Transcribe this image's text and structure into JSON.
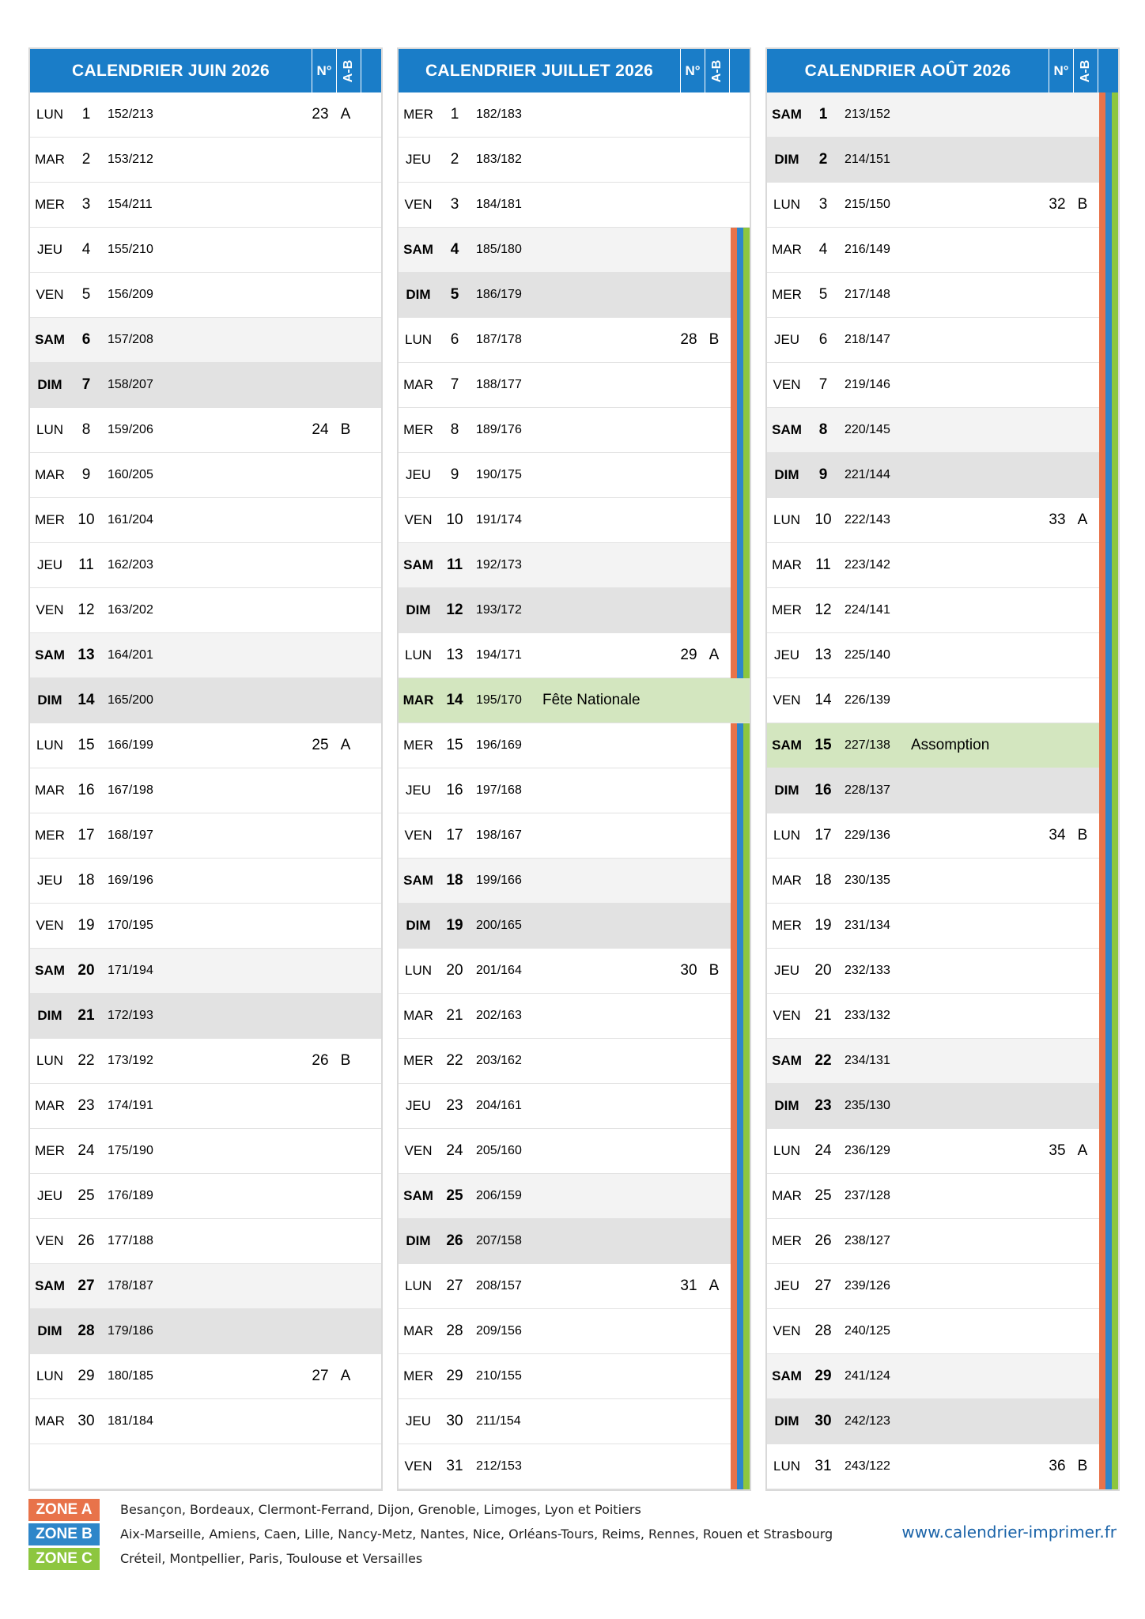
{
  "colors": {
    "header": "#1a7dc8",
    "zone_a": "#e8734a",
    "zone_b": "#2e86c9",
    "zone_c": "#8dc63f",
    "holiday": "#d3e6bf",
    "saturday": "#f3f3f3",
    "sunday": "#e2e2e2"
  },
  "months": [
    {
      "title": "CALENDRIER JUIN 2026",
      "col_no": "N°",
      "col_ab": "A-B",
      "days": [
        {
          "dn": "LUN",
          "d": "1",
          "y": "152/213",
          "hol": "",
          "wk": "23",
          "ab": "A",
          "t": "w",
          "z": false
        },
        {
          "dn": "MAR",
          "d": "2",
          "y": "153/212",
          "hol": "",
          "wk": "",
          "ab": "",
          "t": "w",
          "z": false
        },
        {
          "dn": "MER",
          "d": "3",
          "y": "154/211",
          "hol": "",
          "wk": "",
          "ab": "",
          "t": "w",
          "z": false
        },
        {
          "dn": "JEU",
          "d": "4",
          "y": "155/210",
          "hol": "",
          "wk": "",
          "ab": "",
          "t": "w",
          "z": false
        },
        {
          "dn": "VEN",
          "d": "5",
          "y": "156/209",
          "hol": "",
          "wk": "",
          "ab": "",
          "t": "w",
          "z": false
        },
        {
          "dn": "SAM",
          "d": "6",
          "y": "157/208",
          "hol": "",
          "wk": "",
          "ab": "",
          "t": "sat",
          "z": false
        },
        {
          "dn": "DIM",
          "d": "7",
          "y": "158/207",
          "hol": "",
          "wk": "",
          "ab": "",
          "t": "sun",
          "z": false
        },
        {
          "dn": "LUN",
          "d": "8",
          "y": "159/206",
          "hol": "",
          "wk": "24",
          "ab": "B",
          "t": "w",
          "z": false
        },
        {
          "dn": "MAR",
          "d": "9",
          "y": "160/205",
          "hol": "",
          "wk": "",
          "ab": "",
          "t": "w",
          "z": false
        },
        {
          "dn": "MER",
          "d": "10",
          "y": "161/204",
          "hol": "",
          "wk": "",
          "ab": "",
          "t": "w",
          "z": false
        },
        {
          "dn": "JEU",
          "d": "11",
          "y": "162/203",
          "hol": "",
          "wk": "",
          "ab": "",
          "t": "w",
          "z": false
        },
        {
          "dn": "VEN",
          "d": "12",
          "y": "163/202",
          "hol": "",
          "wk": "",
          "ab": "",
          "t": "w",
          "z": false
        },
        {
          "dn": "SAM",
          "d": "13",
          "y": "164/201",
          "hol": "",
          "wk": "",
          "ab": "",
          "t": "sat",
          "z": false
        },
        {
          "dn": "DIM",
          "d": "14",
          "y": "165/200",
          "hol": "",
          "wk": "",
          "ab": "",
          "t": "sun",
          "z": false
        },
        {
          "dn": "LUN",
          "d": "15",
          "y": "166/199",
          "hol": "",
          "wk": "25",
          "ab": "A",
          "t": "w",
          "z": false
        },
        {
          "dn": "MAR",
          "d": "16",
          "y": "167/198",
          "hol": "",
          "wk": "",
          "ab": "",
          "t": "w",
          "z": false
        },
        {
          "dn": "MER",
          "d": "17",
          "y": "168/197",
          "hol": "",
          "wk": "",
          "ab": "",
          "t": "w",
          "z": false
        },
        {
          "dn": "JEU",
          "d": "18",
          "y": "169/196",
          "hol": "",
          "wk": "",
          "ab": "",
          "t": "w",
          "z": false
        },
        {
          "dn": "VEN",
          "d": "19",
          "y": "170/195",
          "hol": "",
          "wk": "",
          "ab": "",
          "t": "w",
          "z": false
        },
        {
          "dn": "SAM",
          "d": "20",
          "y": "171/194",
          "hol": "",
          "wk": "",
          "ab": "",
          "t": "sat",
          "z": false
        },
        {
          "dn": "DIM",
          "d": "21",
          "y": "172/193",
          "hol": "",
          "wk": "",
          "ab": "",
          "t": "sun",
          "z": false
        },
        {
          "dn": "LUN",
          "d": "22",
          "y": "173/192",
          "hol": "",
          "wk": "26",
          "ab": "B",
          "t": "w",
          "z": false
        },
        {
          "dn": "MAR",
          "d": "23",
          "y": "174/191",
          "hol": "",
          "wk": "",
          "ab": "",
          "t": "w",
          "z": false
        },
        {
          "dn": "MER",
          "d": "24",
          "y": "175/190",
          "hol": "",
          "wk": "",
          "ab": "",
          "t": "w",
          "z": false
        },
        {
          "dn": "JEU",
          "d": "25",
          "y": "176/189",
          "hol": "",
          "wk": "",
          "ab": "",
          "t": "w",
          "z": false
        },
        {
          "dn": "VEN",
          "d": "26",
          "y": "177/188",
          "hol": "",
          "wk": "",
          "ab": "",
          "t": "w",
          "z": false
        },
        {
          "dn": "SAM",
          "d": "27",
          "y": "178/187",
          "hol": "",
          "wk": "",
          "ab": "",
          "t": "sat",
          "z": false
        },
        {
          "dn": "DIM",
          "d": "28",
          "y": "179/186",
          "hol": "",
          "wk": "",
          "ab": "",
          "t": "sun",
          "z": false
        },
        {
          "dn": "LUN",
          "d": "29",
          "y": "180/185",
          "hol": "",
          "wk": "27",
          "ab": "A",
          "t": "w",
          "z": false
        },
        {
          "dn": "MAR",
          "d": "30",
          "y": "181/184",
          "hol": "",
          "wk": "",
          "ab": "",
          "t": "w",
          "z": false
        },
        {
          "dn": "",
          "d": "",
          "y": "",
          "hol": "",
          "wk": "",
          "ab": "",
          "t": "empty",
          "z": false
        }
      ]
    },
    {
      "title": "CALENDRIER JUILLET 2026",
      "col_no": "N°",
      "col_ab": "A-B",
      "days": [
        {
          "dn": "MER",
          "d": "1",
          "y": "182/183",
          "hol": "",
          "wk": "",
          "ab": "",
          "t": "w",
          "z": false
        },
        {
          "dn": "JEU",
          "d": "2",
          "y": "183/182",
          "hol": "",
          "wk": "",
          "ab": "",
          "t": "w",
          "z": false
        },
        {
          "dn": "VEN",
          "d": "3",
          "y": "184/181",
          "hol": "",
          "wk": "",
          "ab": "",
          "t": "w",
          "z": false
        },
        {
          "dn": "SAM",
          "d": "4",
          "y": "185/180",
          "hol": "",
          "wk": "",
          "ab": "",
          "t": "sat",
          "z": true
        },
        {
          "dn": "DIM",
          "d": "5",
          "y": "186/179",
          "hol": "",
          "wk": "",
          "ab": "",
          "t": "sun",
          "z": true
        },
        {
          "dn": "LUN",
          "d": "6",
          "y": "187/178",
          "hol": "",
          "wk": "28",
          "ab": "B",
          "t": "w",
          "z": true
        },
        {
          "dn": "MAR",
          "d": "7",
          "y": "188/177",
          "hol": "",
          "wk": "",
          "ab": "",
          "t": "w",
          "z": true
        },
        {
          "dn": "MER",
          "d": "8",
          "y": "189/176",
          "hol": "",
          "wk": "",
          "ab": "",
          "t": "w",
          "z": true
        },
        {
          "dn": "JEU",
          "d": "9",
          "y": "190/175",
          "hol": "",
          "wk": "",
          "ab": "",
          "t": "w",
          "z": true
        },
        {
          "dn": "VEN",
          "d": "10",
          "y": "191/174",
          "hol": "",
          "wk": "",
          "ab": "",
          "t": "w",
          "z": true
        },
        {
          "dn": "SAM",
          "d": "11",
          "y": "192/173",
          "hol": "",
          "wk": "",
          "ab": "",
          "t": "sat",
          "z": true
        },
        {
          "dn": "DIM",
          "d": "12",
          "y": "193/172",
          "hol": "",
          "wk": "",
          "ab": "",
          "t": "sun",
          "z": true
        },
        {
          "dn": "LUN",
          "d": "13",
          "y": "194/171",
          "hol": "",
          "wk": "29",
          "ab": "A",
          "t": "w",
          "z": true
        },
        {
          "dn": "MAR",
          "d": "14",
          "y": "195/170",
          "hol": "Fête Nationale",
          "wk": "",
          "ab": "",
          "t": "hol",
          "z": false
        },
        {
          "dn": "MER",
          "d": "15",
          "y": "196/169",
          "hol": "",
          "wk": "",
          "ab": "",
          "t": "w",
          "z": true
        },
        {
          "dn": "JEU",
          "d": "16",
          "y": "197/168",
          "hol": "",
          "wk": "",
          "ab": "",
          "t": "w",
          "z": true
        },
        {
          "dn": "VEN",
          "d": "17",
          "y": "198/167",
          "hol": "",
          "wk": "",
          "ab": "",
          "t": "w",
          "z": true
        },
        {
          "dn": "SAM",
          "d": "18",
          "y": "199/166",
          "hol": "",
          "wk": "",
          "ab": "",
          "t": "sat",
          "z": true
        },
        {
          "dn": "DIM",
          "d": "19",
          "y": "200/165",
          "hol": "",
          "wk": "",
          "ab": "",
          "t": "sun",
          "z": true
        },
        {
          "dn": "LUN",
          "d": "20",
          "y": "201/164",
          "hol": "",
          "wk": "30",
          "ab": "B",
          "t": "w",
          "z": true
        },
        {
          "dn": "MAR",
          "d": "21",
          "y": "202/163",
          "hol": "",
          "wk": "",
          "ab": "",
          "t": "w",
          "z": true
        },
        {
          "dn": "MER",
          "d": "22",
          "y": "203/162",
          "hol": "",
          "wk": "",
          "ab": "",
          "t": "w",
          "z": true
        },
        {
          "dn": "JEU",
          "d": "23",
          "y": "204/161",
          "hol": "",
          "wk": "",
          "ab": "",
          "t": "w",
          "z": true
        },
        {
          "dn": "VEN",
          "d": "24",
          "y": "205/160",
          "hol": "",
          "wk": "",
          "ab": "",
          "t": "w",
          "z": true
        },
        {
          "dn": "SAM",
          "d": "25",
          "y": "206/159",
          "hol": "",
          "wk": "",
          "ab": "",
          "t": "sat",
          "z": true
        },
        {
          "dn": "DIM",
          "d": "26",
          "y": "207/158",
          "hol": "",
          "wk": "",
          "ab": "",
          "t": "sun",
          "z": true
        },
        {
          "dn": "LUN",
          "d": "27",
          "y": "208/157",
          "hol": "",
          "wk": "31",
          "ab": "A",
          "t": "w",
          "z": true
        },
        {
          "dn": "MAR",
          "d": "28",
          "y": "209/156",
          "hol": "",
          "wk": "",
          "ab": "",
          "t": "w",
          "z": true
        },
        {
          "dn": "MER",
          "d": "29",
          "y": "210/155",
          "hol": "",
          "wk": "",
          "ab": "",
          "t": "w",
          "z": true
        },
        {
          "dn": "JEU",
          "d": "30",
          "y": "211/154",
          "hol": "",
          "wk": "",
          "ab": "",
          "t": "w",
          "z": true
        },
        {
          "dn": "VEN",
          "d": "31",
          "y": "212/153",
          "hol": "",
          "wk": "",
          "ab": "",
          "t": "w",
          "z": true
        }
      ]
    },
    {
      "title": "CALENDRIER AOÛT 2026",
      "col_no": "N°",
      "col_ab": "A-B",
      "days": [
        {
          "dn": "SAM",
          "d": "1",
          "y": "213/152",
          "hol": "",
          "wk": "",
          "ab": "",
          "t": "sat",
          "z": true
        },
        {
          "dn": "DIM",
          "d": "2",
          "y": "214/151",
          "hol": "",
          "wk": "",
          "ab": "",
          "t": "sun",
          "z": true
        },
        {
          "dn": "LUN",
          "d": "3",
          "y": "215/150",
          "hol": "",
          "wk": "32",
          "ab": "B",
          "t": "w",
          "z": true
        },
        {
          "dn": "MAR",
          "d": "4",
          "y": "216/149",
          "hol": "",
          "wk": "",
          "ab": "",
          "t": "w",
          "z": true
        },
        {
          "dn": "MER",
          "d": "5",
          "y": "217/148",
          "hol": "",
          "wk": "",
          "ab": "",
          "t": "w",
          "z": true
        },
        {
          "dn": "JEU",
          "d": "6",
          "y": "218/147",
          "hol": "",
          "wk": "",
          "ab": "",
          "t": "w",
          "z": true
        },
        {
          "dn": "VEN",
          "d": "7",
          "y": "219/146",
          "hol": "",
          "wk": "",
          "ab": "",
          "t": "w",
          "z": true
        },
        {
          "dn": "SAM",
          "d": "8",
          "y": "220/145",
          "hol": "",
          "wk": "",
          "ab": "",
          "t": "sat",
          "z": true
        },
        {
          "dn": "DIM",
          "d": "9",
          "y": "221/144",
          "hol": "",
          "wk": "",
          "ab": "",
          "t": "sun",
          "z": true
        },
        {
          "dn": "LUN",
          "d": "10",
          "y": "222/143",
          "hol": "",
          "wk": "33",
          "ab": "A",
          "t": "w",
          "z": true
        },
        {
          "dn": "MAR",
          "d": "11",
          "y": "223/142",
          "hol": "",
          "wk": "",
          "ab": "",
          "t": "w",
          "z": true
        },
        {
          "dn": "MER",
          "d": "12",
          "y": "224/141",
          "hol": "",
          "wk": "",
          "ab": "",
          "t": "w",
          "z": true
        },
        {
          "dn": "JEU",
          "d": "13",
          "y": "225/140",
          "hol": "",
          "wk": "",
          "ab": "",
          "t": "w",
          "z": true
        },
        {
          "dn": "VEN",
          "d": "14",
          "y": "226/139",
          "hol": "",
          "wk": "",
          "ab": "",
          "t": "w",
          "z": true
        },
        {
          "dn": "SAM",
          "d": "15",
          "y": "227/138",
          "hol": "Assomption",
          "wk": "",
          "ab": "",
          "t": "hol",
          "z": true
        },
        {
          "dn": "DIM",
          "d": "16",
          "y": "228/137",
          "hol": "",
          "wk": "",
          "ab": "",
          "t": "sun",
          "z": true
        },
        {
          "dn": "LUN",
          "d": "17",
          "y": "229/136",
          "hol": "",
          "wk": "34",
          "ab": "B",
          "t": "w",
          "z": true
        },
        {
          "dn": "MAR",
          "d": "18",
          "y": "230/135",
          "hol": "",
          "wk": "",
          "ab": "",
          "t": "w",
          "z": true
        },
        {
          "dn": "MER",
          "d": "19",
          "y": "231/134",
          "hol": "",
          "wk": "",
          "ab": "",
          "t": "w",
          "z": true
        },
        {
          "dn": "JEU",
          "d": "20",
          "y": "232/133",
          "hol": "",
          "wk": "",
          "ab": "",
          "t": "w",
          "z": true
        },
        {
          "dn": "VEN",
          "d": "21",
          "y": "233/132",
          "hol": "",
          "wk": "",
          "ab": "",
          "t": "w",
          "z": true
        },
        {
          "dn": "SAM",
          "d": "22",
          "y": "234/131",
          "hol": "",
          "wk": "",
          "ab": "",
          "t": "sat",
          "z": true
        },
        {
          "dn": "DIM",
          "d": "23",
          "y": "235/130",
          "hol": "",
          "wk": "",
          "ab": "",
          "t": "sun",
          "z": true
        },
        {
          "dn": "LUN",
          "d": "24",
          "y": "236/129",
          "hol": "",
          "wk": "35",
          "ab": "A",
          "t": "w",
          "z": true
        },
        {
          "dn": "MAR",
          "d": "25",
          "y": "237/128",
          "hol": "",
          "wk": "",
          "ab": "",
          "t": "w",
          "z": true
        },
        {
          "dn": "MER",
          "d": "26",
          "y": "238/127",
          "hol": "",
          "wk": "",
          "ab": "",
          "t": "w",
          "z": true
        },
        {
          "dn": "JEU",
          "d": "27",
          "y": "239/126",
          "hol": "",
          "wk": "",
          "ab": "",
          "t": "w",
          "z": true
        },
        {
          "dn": "VEN",
          "d": "28",
          "y": "240/125",
          "hol": "",
          "wk": "",
          "ab": "",
          "t": "w",
          "z": true
        },
        {
          "dn": "SAM",
          "d": "29",
          "y": "241/124",
          "hol": "",
          "wk": "",
          "ab": "",
          "t": "sat",
          "z": true
        },
        {
          "dn": "DIM",
          "d": "30",
          "y": "242/123",
          "hol": "",
          "wk": "",
          "ab": "",
          "t": "sun",
          "z": true
        },
        {
          "dn": "LUN",
          "d": "31",
          "y": "243/122",
          "hol": "",
          "wk": "36",
          "ab": "B",
          "t": "w",
          "z": true
        }
      ]
    }
  ],
  "legend": [
    {
      "label": "ZONE A",
      "text": "Besançon, Bordeaux, Clermont-Ferrand, Dijon, Grenoble, Limoges, Lyon et Poitiers",
      "color": "#e8734a"
    },
    {
      "label": "ZONE B",
      "text": "Aix-Marseille, Amiens, Caen, Lille, Nancy-Metz, Nantes, Nice, Orléans-Tours, Reims, Rennes, Rouen et Strasbourg",
      "color": "#2e86c9"
    },
    {
      "label": "ZONE C",
      "text": "Créteil, Montpellier, Paris, Toulouse et Versailles",
      "color": "#8dc63f"
    }
  ],
  "website": "www.calendrier-imprimer.fr"
}
